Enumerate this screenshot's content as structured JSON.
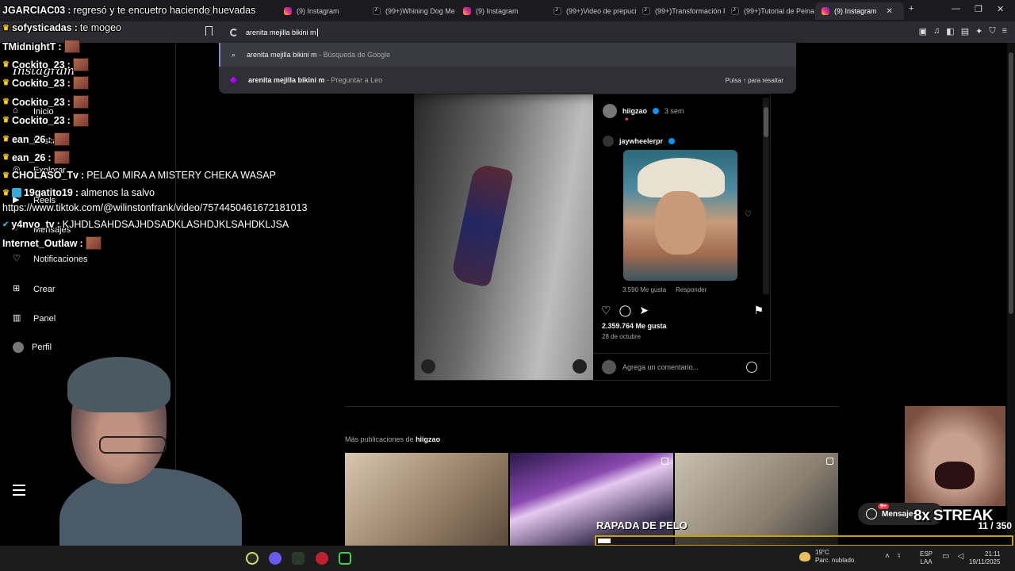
{
  "browser": {
    "tabs": [
      {
        "label": "JGARCIAC03 y te encuetro haciendo huevadas",
        "icon": "twitch",
        "active": false
      },
      {
        "label": "(9) Instagram",
        "icon": "instagram",
        "active": false
      },
      {
        "label": "(99+)Whining Dog Me",
        "icon": "tiktok",
        "active": false
      },
      {
        "label": "(9) Instagram",
        "icon": "instagram",
        "active": false
      },
      {
        "label": "(99+)Video de prepuci",
        "icon": "tiktok",
        "active": false
      },
      {
        "label": "(99+)Transformación F",
        "icon": "tiktok",
        "active": false
      },
      {
        "label": "(99+)Tutorial de Peina",
        "icon": "tiktok",
        "active": false
      },
      {
        "label": "(9) Instagram",
        "icon": "instagram",
        "active": true
      }
    ],
    "new_tab": "+",
    "address_value": "arenita mejilla bikini m",
    "suggestions": [
      {
        "text": "arenita mejilla bikini m",
        "suffix": " - Búsqueda de Google"
      },
      {
        "text": "arenita mejilla bikini m",
        "suffix": " - Preguntar a Leo",
        "hint": "Pulsa ↑ para resaltar"
      }
    ]
  },
  "instagram": {
    "logo": "Instagram",
    "nav": [
      {
        "label": "Inicio",
        "icon": "home-icon"
      },
      {
        "label": "Buscar",
        "icon": "search-icon"
      },
      {
        "label": "Explorar",
        "icon": "compass-icon"
      },
      {
        "label": "Reels",
        "icon": "reels-icon"
      },
      {
        "label": "Mensajes",
        "icon": "messenger-icon"
      },
      {
        "label": "Notificaciones",
        "icon": "heart-icon"
      },
      {
        "label": "Crear",
        "icon": "plus-square-icon"
      },
      {
        "label": "Panel",
        "icon": "dashboard-icon"
      },
      {
        "label": "Perfil",
        "icon": "profile-avatar"
      }
    ],
    "post": {
      "author": "hiigzao",
      "age": "3 sem",
      "caption_emoji": "♥",
      "shared_author": "jaywheelerpr",
      "shared_likes": "3.590 Me gusta",
      "reply_label": "Responder",
      "likes": "2.359.764 Me gusta",
      "date": "28 de octubre",
      "comment_placeholder": "Agrega un comentario..."
    },
    "more_posts": {
      "prefix": "Más publicaciones de ",
      "author": "hiigzao"
    },
    "messages_button": "Mensajes",
    "messages_badge": "9+"
  },
  "stream_overlay": {
    "chat": [
      {
        "user": "JGARCIAC03",
        "message": " regresó y te encuetro haciendo huevadas",
        "badge": ""
      },
      {
        "user": "sofysticadas",
        "message": " te mogeo",
        "badge": "👑"
      },
      {
        "user": "TMidnightT",
        "message": "",
        "badge": "",
        "emote": true
      },
      {
        "user": "Cockito_23",
        "message": "",
        "badge": "👑",
        "emote": true
      },
      {
        "user": "Cockito_23",
        "message": "",
        "badge": "👑",
        "emote": true
      },
      {
        "user": "Cockito_23",
        "message": "",
        "badge": "👑",
        "emote": true
      },
      {
        "user": "Cockito_23",
        "message": "",
        "badge": "👑",
        "emote": true
      },
      {
        "user": "ean_26",
        "message": "",
        "badge": "👑",
        "emote": true
      },
      {
        "user": "ean_26",
        "message": "",
        "badge": "👑",
        "emote": true
      },
      {
        "user": "CHOLASO_Tv",
        "message": " PELAO MIRA A MISTERY CHEKA WASAP",
        "badge": "👑"
      },
      {
        "user": "19gatito19",
        "message": " almenos la salvo",
        "badge": "👑"
      },
      {
        "user": "",
        "message": "https://www.tiktok.com/@wilinstonfrank/video/7574450461672181013",
        "badge": ""
      },
      {
        "user": "y4nvo_tv",
        "message": " KJHDLSAHDSAJHDSADKLASHDJKLSAHDKLJSA",
        "badge": "✔"
      },
      {
        "user": "Internet_Outlaw",
        "message": "",
        "badge": "",
        "emote": true
      }
    ],
    "streak": "8x STREAK",
    "goal_label": "RAPADA DE PELO",
    "goal_count": "11 / 350",
    "goal_progress": 0.031
  },
  "taskbar": {
    "temperature": "19°C",
    "weather": "Parc. nublado",
    "lang_top": "ESP",
    "lang_bottom": "LAA",
    "time": "21:11",
    "date": "19/11/2025"
  }
}
